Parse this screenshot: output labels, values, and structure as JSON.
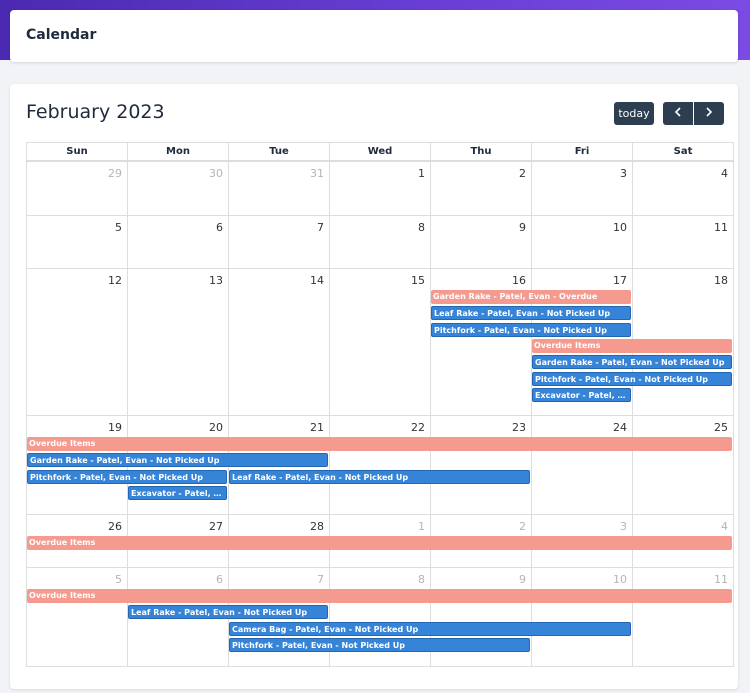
{
  "header": {
    "title": "Calendar"
  },
  "calendar": {
    "month_title": "February 2023",
    "today_label": "today",
    "prev_icon": "chevron-left-icon",
    "next_icon": "chevron-right-icon",
    "weekdays": [
      "Sun",
      "Mon",
      "Tue",
      "Wed",
      "Thu",
      "Fri",
      "Sat"
    ],
    "weeks": [
      {
        "days": [
          {
            "n": "29",
            "other": true
          },
          {
            "n": "30",
            "other": true
          },
          {
            "n": "31",
            "other": true
          },
          {
            "n": "1"
          },
          {
            "n": "2"
          },
          {
            "n": "3"
          },
          {
            "n": "4"
          }
        ]
      },
      {
        "days": [
          {
            "n": "5"
          },
          {
            "n": "6"
          },
          {
            "n": "7"
          },
          {
            "n": "8"
          },
          {
            "n": "9"
          },
          {
            "n": "10"
          },
          {
            "n": "11"
          }
        ]
      },
      {
        "days": [
          {
            "n": "12"
          },
          {
            "n": "13"
          },
          {
            "n": "14"
          },
          {
            "n": "15"
          },
          {
            "n": "16"
          },
          {
            "n": "17"
          },
          {
            "n": "18"
          }
        ]
      },
      {
        "days": [
          {
            "n": "19"
          },
          {
            "n": "20"
          },
          {
            "n": "21"
          },
          {
            "n": "22"
          },
          {
            "n": "23"
          },
          {
            "n": "24"
          },
          {
            "n": "25"
          }
        ]
      },
      {
        "days": [
          {
            "n": "26"
          },
          {
            "n": "27"
          },
          {
            "n": "28"
          },
          {
            "n": "1",
            "other": true
          },
          {
            "n": "2",
            "other": true
          },
          {
            "n": "3",
            "other": true
          },
          {
            "n": "4",
            "other": true
          }
        ]
      },
      {
        "days": [
          {
            "n": "5",
            "other": true
          },
          {
            "n": "6",
            "other": true
          },
          {
            "n": "7",
            "other": true
          },
          {
            "n": "8",
            "other": true
          },
          {
            "n": "9",
            "other": true
          },
          {
            "n": "10",
            "other": true
          },
          {
            "n": "11",
            "other": true
          }
        ]
      }
    ],
    "events": [
      {
        "week": 2,
        "start": 4,
        "span": 2,
        "lane": 0,
        "type": "overdue",
        "title": "Garden Rake - Patel, Evan - Overdue"
      },
      {
        "week": 2,
        "start": 4,
        "span": 2,
        "lane": 1,
        "type": "pick",
        "title": "Leaf Rake - Patel, Evan - Not Picked Up"
      },
      {
        "week": 2,
        "start": 4,
        "span": 2,
        "lane": 2,
        "type": "pick",
        "title": "Pitchfork - Patel, Evan - Not Picked Up"
      },
      {
        "week": 2,
        "start": 5,
        "span": 2,
        "lane": 3,
        "type": "overdue",
        "title": "Overdue Items"
      },
      {
        "week": 2,
        "start": 5,
        "span": 2,
        "lane": 4,
        "type": "pick",
        "title": "Garden Rake - Patel, Evan - Not Picked Up"
      },
      {
        "week": 2,
        "start": 5,
        "span": 2,
        "lane": 5,
        "type": "pick",
        "title": "Pitchfork - Patel, Evan - Not Picked Up"
      },
      {
        "week": 2,
        "start": 5,
        "span": 1,
        "lane": 6,
        "type": "pick",
        "title": "Excavator - Patel, Evan"
      },
      {
        "week": 3,
        "start": 0,
        "span": 7,
        "lane": 0,
        "type": "overdue",
        "title": "Overdue Items"
      },
      {
        "week": 3,
        "start": 0,
        "span": 3,
        "lane": 1,
        "type": "pick",
        "title": "Garden Rake - Patel, Evan - Not Picked Up"
      },
      {
        "week": 3,
        "start": 0,
        "span": 2,
        "lane": 2,
        "type": "pick",
        "title": "Pitchfork - Patel, Evan - Not Picked Up"
      },
      {
        "week": 3,
        "start": 2,
        "span": 3,
        "lane": 2,
        "type": "pick",
        "title": "Leaf Rake - Patel, Evan - Not Picked Up"
      },
      {
        "week": 3,
        "start": 1,
        "span": 1,
        "lane": 3,
        "type": "pick",
        "title": "Excavator - Patel, Evan - Not Picked Up"
      },
      {
        "week": 4,
        "start": 0,
        "span": 7,
        "lane": 0,
        "type": "overdue",
        "title": "Overdue Items"
      },
      {
        "week": 5,
        "start": 0,
        "span": 7,
        "lane": 0,
        "type": "overdue",
        "title": "Overdue Items"
      },
      {
        "week": 5,
        "start": 1,
        "span": 2,
        "lane": 1,
        "type": "pick",
        "title": "Leaf Rake - Patel, Evan - Not Picked Up"
      },
      {
        "week": 5,
        "start": 2,
        "span": 4,
        "lane": 2,
        "type": "pick",
        "title": "Camera Bag - Patel, Evan - Not Picked Up"
      },
      {
        "week": 5,
        "start": 2,
        "span": 3,
        "lane": 3,
        "type": "pick",
        "title": "Pitchfork - Patel, Evan - Not Picked Up"
      }
    ]
  }
}
